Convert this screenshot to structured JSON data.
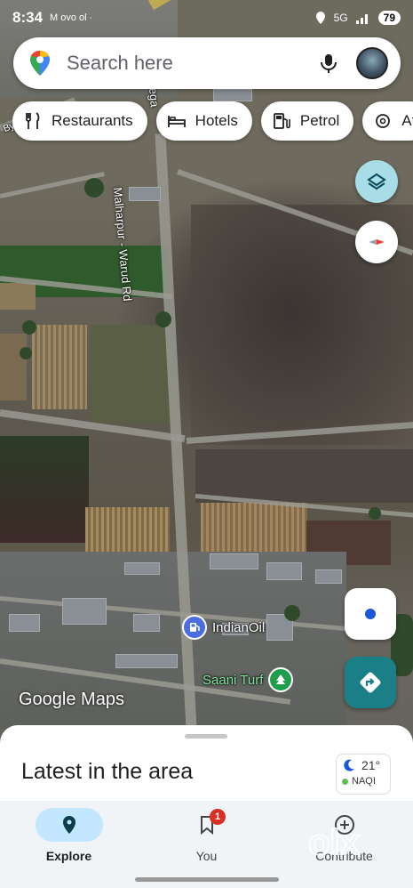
{
  "status_bar": {
    "time": "8:34",
    "left_icons": "M ovo ol ∙",
    "signal_text": "5G",
    "battery": "79"
  },
  "search": {
    "placeholder": "Search here"
  },
  "chips": [
    {
      "label": "Restaurants",
      "icon": "fork-knife-icon"
    },
    {
      "label": "Hotels",
      "icon": "bed-icon"
    },
    {
      "label": "Petrol",
      "icon": "fuel-pump-icon"
    },
    {
      "label": "At",
      "icon": "attraction-icon"
    }
  ],
  "map": {
    "road_label": "Malharpur - Warud Rd",
    "top_left_road": "Bypass Rd",
    "left_road_snippet": "ega",
    "pois": [
      {
        "label": "IndianOil",
        "color": "#4a6ee0",
        "icon": "fuel-pump-icon"
      },
      {
        "label": "Saani Turf",
        "color": "#1e9e4a",
        "icon": "tree-icon"
      }
    ],
    "attribution": "Google Maps"
  },
  "sheet": {
    "title": "Latest in the area",
    "weather": {
      "temp": "21°",
      "aqi_label": "NAQI",
      "icon": "moon-icon"
    }
  },
  "nav": [
    {
      "label": "Explore",
      "icon": "explore-pin-icon",
      "active": true
    },
    {
      "label": "You",
      "icon": "bookmark-icon",
      "badge": "1"
    },
    {
      "label": "Contribute",
      "icon": "add-circle-icon"
    }
  ],
  "watermark": "olx",
  "colors": {
    "accent": "#1a7f86",
    "explore_pill": "#c2e7ff",
    "badge": "#d93025"
  }
}
